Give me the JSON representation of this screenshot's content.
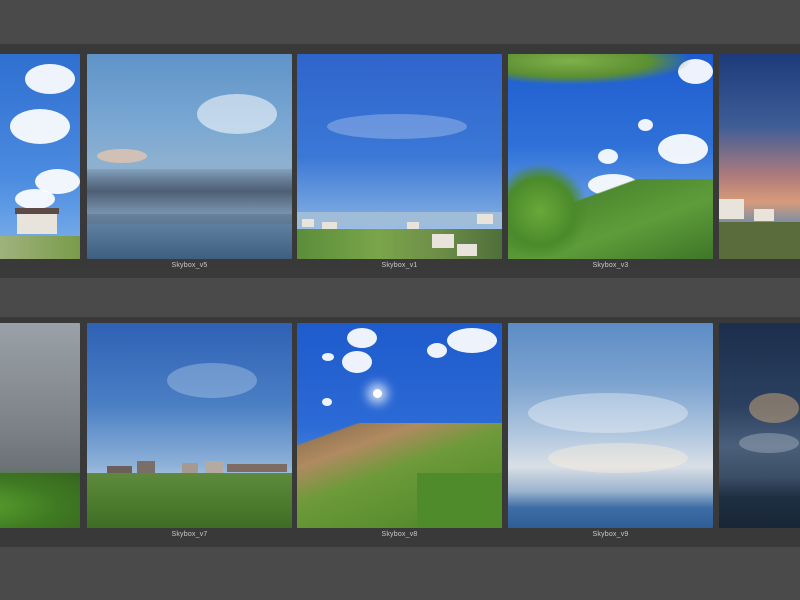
{
  "row1": [
    {
      "label": ""
    },
    {
      "label": "Skybox_v5"
    },
    {
      "label": "Skybox_v1"
    },
    {
      "label": "Skybox_v3"
    },
    {
      "label": ""
    }
  ],
  "row2": [
    {
      "label": ""
    },
    {
      "label": "Skybox_v7"
    },
    {
      "label": "Skybox_v8"
    },
    {
      "label": "Skybox_v9"
    },
    {
      "label": ""
    }
  ]
}
